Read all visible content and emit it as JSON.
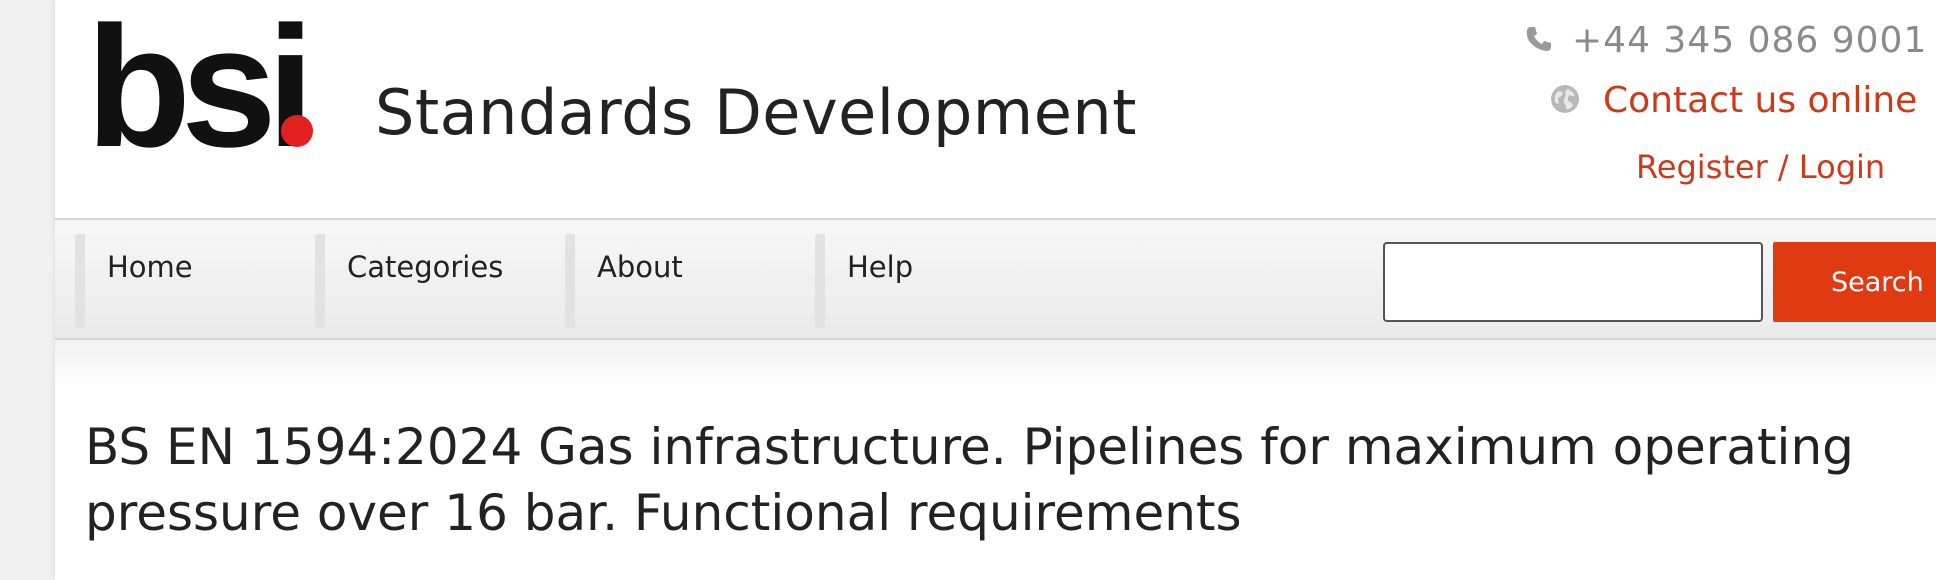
{
  "header": {
    "logo_text": "bsi",
    "site_title": "Standards Development",
    "phone": "+44 345 086 9001",
    "contact_online": "Contact us online",
    "register_login": "Register / Login"
  },
  "nav": {
    "items": [
      {
        "label": "Home"
      },
      {
        "label": "Categories"
      },
      {
        "label": "About"
      },
      {
        "label": "Help"
      }
    ],
    "search": {
      "value": "",
      "button_label": "Search"
    }
  },
  "main": {
    "title": "BS EN 1594:2024 Gas infrastructure. Pipelines for maximum operating pressure over 16 bar. Functional requirements"
  },
  "icons": {
    "phone": "phone-icon",
    "globe": "globe-icon"
  },
  "colors": {
    "accent": "#cc3a1a",
    "search_button": "#e03a12",
    "logo_dot": "#e2201f",
    "text": "#222222",
    "muted": "#8a8a8a"
  }
}
